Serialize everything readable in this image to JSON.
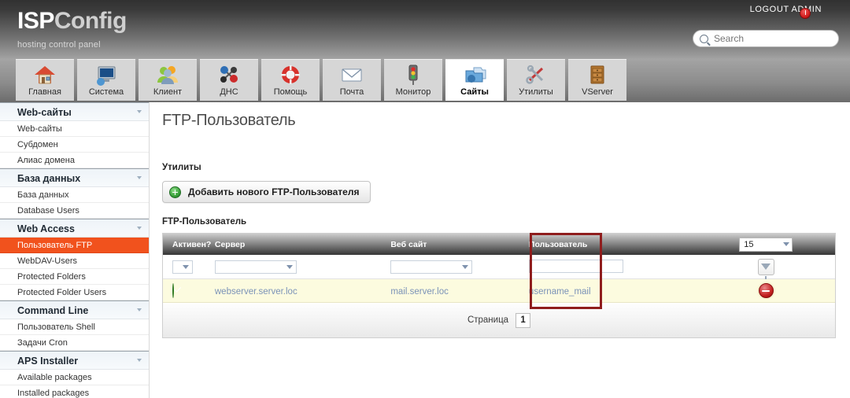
{
  "header": {
    "brand_isp": "ISP",
    "brand_config": "Config",
    "subtitle": "hosting control panel",
    "logout_label": "LOGOUT ADMIN",
    "power_icon": "power-icon",
    "search": {
      "icon": "search-icon",
      "value": "",
      "placeholder": "Search"
    }
  },
  "tabs": [
    {
      "label": "Главная",
      "icon": "home-icon",
      "active": false
    },
    {
      "label": "Система",
      "icon": "monitor-icon",
      "active": false
    },
    {
      "label": "Клиент",
      "icon": "users-icon",
      "active": false
    },
    {
      "label": "ДНС",
      "icon": "molecule-icon",
      "active": false
    },
    {
      "label": "Помощь",
      "icon": "lifering-icon",
      "active": false
    },
    {
      "label": "Почта",
      "icon": "envelope-icon",
      "active": false
    },
    {
      "label": "Монитор",
      "icon": "trafficlight-icon",
      "active": false
    },
    {
      "label": "Сайты",
      "icon": "folders-icon",
      "active": true
    },
    {
      "label": "Утилиты",
      "icon": "tools-icon",
      "active": false
    },
    {
      "label": "VServer",
      "icon": "cabinet-icon",
      "active": false
    }
  ],
  "sidebar": {
    "groups": [
      {
        "title": "Web-сайты",
        "items": [
          {
            "label": "Web-сайты",
            "active": false
          },
          {
            "label": "Субдомен",
            "active": false
          },
          {
            "label": "Алиас домена",
            "active": false
          }
        ]
      },
      {
        "title": "База данных",
        "items": [
          {
            "label": "База данных",
            "active": false
          },
          {
            "label": "Database Users",
            "active": false
          }
        ]
      },
      {
        "title": "Web Access",
        "items": [
          {
            "label": "Пользователь FTP",
            "active": true
          },
          {
            "label": "WebDAV-Users",
            "active": false
          },
          {
            "label": "Protected Folders",
            "active": false
          },
          {
            "label": "Protected Folder Users",
            "active": false
          }
        ]
      },
      {
        "title": "Command Line",
        "items": [
          {
            "label": "Пользователь Shell",
            "active": false
          },
          {
            "label": "Задачи Cron",
            "active": false
          }
        ]
      },
      {
        "title": "APS Installer",
        "items": [
          {
            "label": "Available packages",
            "active": false
          },
          {
            "label": "Installed packages",
            "active": false
          }
        ]
      }
    ]
  },
  "main": {
    "page_title": "FTP-Пользователь",
    "tools_label": "Утилиты",
    "add_button_label": "Добавить нового FTP-Пользователя",
    "add_button_icon": "plus-circle-icon",
    "table_label": "FTP-Пользователь",
    "table": {
      "columns": [
        "Активен?",
        "Сервер",
        "Веб сайт",
        "Пользователь"
      ],
      "page_size": "15",
      "filter": {
        "active_value": "",
        "server_value": "",
        "website_value": "",
        "user_value": "",
        "button_icon": "funnel-icon"
      },
      "rows": [
        {
          "active": true,
          "active_icon": "green-check-icon",
          "server": "webserver.server.loc",
          "website": "mail.server.loc",
          "user": "username_mail",
          "delete_icon": "delete-icon"
        }
      ],
      "footer": {
        "page_label": "Страница",
        "page_number": "1"
      }
    }
  },
  "annotation": {
    "color": "#8f1d1d",
    "target": "Пользователь"
  }
}
